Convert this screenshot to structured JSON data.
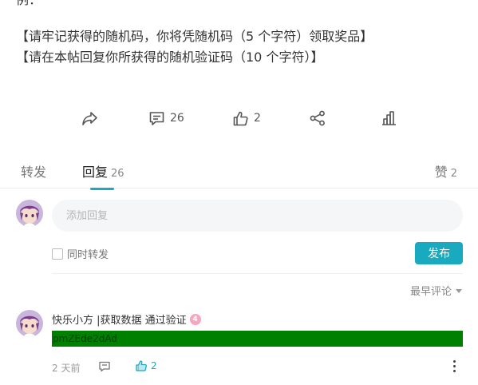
{
  "post": {
    "cut_text": "例：",
    "line1": "【请牢记获得的随机码，你将凭随机码（5 个字符）领取奖品】",
    "line2": "【请在本帖回复你所获得的随机验证码（10 个字符）】"
  },
  "actions": {
    "comment_count": "26",
    "like_count": "2"
  },
  "tabs": {
    "forward_label": "转发",
    "reply_label": "回复",
    "reply_count": "26",
    "like_label": "赞",
    "like_count": "2"
  },
  "reply_box": {
    "placeholder": "添加回复",
    "sync_label": "同时转发",
    "publish_label": "发布"
  },
  "sort": {
    "label": "最早评论"
  },
  "comment": {
    "username": "快乐小方 |获取数据 通过验证",
    "badge": "4",
    "body": "pmZEde2dAd",
    "time": "2 天前",
    "like_count": "2",
    "highlight_color": "#008000"
  },
  "colors": {
    "accent": "#1aaabf"
  },
  "icons": [
    "forward-icon",
    "comment-icon",
    "like-icon",
    "share-icon",
    "stats-icon",
    "chevron-down-icon",
    "more-icon"
  ]
}
